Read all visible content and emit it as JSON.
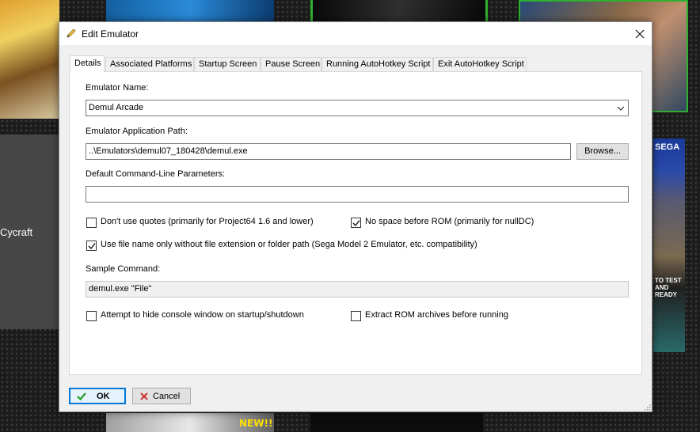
{
  "background": {
    "side_label": "Cycraft",
    "tile_texts": [
      "SEGA",
      "TO TEST AND READY",
      "NEW!!"
    ]
  },
  "dialog": {
    "title": "Edit Emulator",
    "icons": {
      "title": "pencil-icon",
      "close": "close-icon"
    },
    "tabs": [
      {
        "label": "Details",
        "active": true
      },
      {
        "label": "Associated Platforms",
        "active": false
      },
      {
        "label": "Startup Screen",
        "active": false
      },
      {
        "label": "Pause Screen",
        "active": false
      },
      {
        "label": "Running AutoHotkey Script",
        "active": false
      },
      {
        "label": "Exit AutoHotkey Script",
        "active": false
      }
    ],
    "details": {
      "emulator_name_label": "Emulator Name:",
      "emulator_name_value": "Demul Arcade",
      "app_path_label": "Emulator Application Path:",
      "app_path_value": "..\\Emulators\\demul07_180428\\demul.exe",
      "browse_label": "Browse...",
      "params_label": "Default Command-Line Parameters:",
      "params_value": "",
      "checkboxes": {
        "no_quotes": {
          "label": "Don't use quotes (primarily for Project64 1.6 and lower)",
          "checked": false
        },
        "no_space": {
          "label": "No space before ROM (primarily for nullDC)",
          "checked": true
        },
        "file_name_only": {
          "label": "Use file name only without file extension or folder path (Sega Model 2 Emulator, etc. compatibility)",
          "checked": true
        },
        "hide_console": {
          "label": "Attempt to hide console window on startup/shutdown",
          "checked": false
        },
        "extract_rom": {
          "label": "Extract ROM archives before running",
          "checked": false
        }
      },
      "sample_command_label": "Sample Command:",
      "sample_command_value": "demul.exe \"File\""
    },
    "buttons": {
      "ok_label": "OK",
      "cancel_label": "Cancel",
      "ok_icon": "checkmark-icon",
      "cancel_icon": "x-icon"
    },
    "colors": {
      "accent": "#0078d7",
      "ok_icon": "#22a022",
      "cancel_icon": "#d03030"
    }
  }
}
